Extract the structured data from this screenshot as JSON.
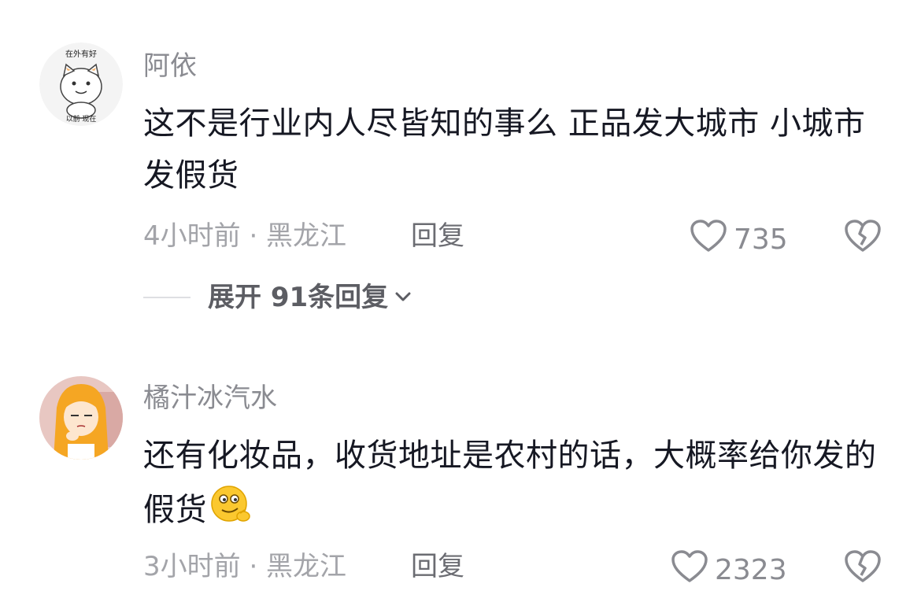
{
  "comments": [
    {
      "username": "阿依",
      "text": "这不是行业内人尽皆知的事么 正品发大城市 小城市发假货",
      "time_location": "4小时前 · 黑龙江",
      "reply_label": "回复",
      "likes": "735",
      "avatar_text_top": "在外有好",
      "avatar_text_bottom": "以前 现在"
    },
    {
      "username": "橘汁冰汽水",
      "text": "还有化妆品，收货地址是农村的话，大概率给你发的假货",
      "time_location": "3小时前 · 黑龙江",
      "reply_label": "回复",
      "likes": "2323",
      "emoji": "smirk-emoji"
    }
  ],
  "expand_replies": {
    "label": "展开 91条回复"
  },
  "icons": {
    "like": "heart-outline-icon",
    "dislike": "broken-heart-icon",
    "expand": "chevron-down-icon"
  },
  "colors": {
    "text": "#161823",
    "username": "#8a8b91",
    "meta": "#a3a4a9"
  }
}
